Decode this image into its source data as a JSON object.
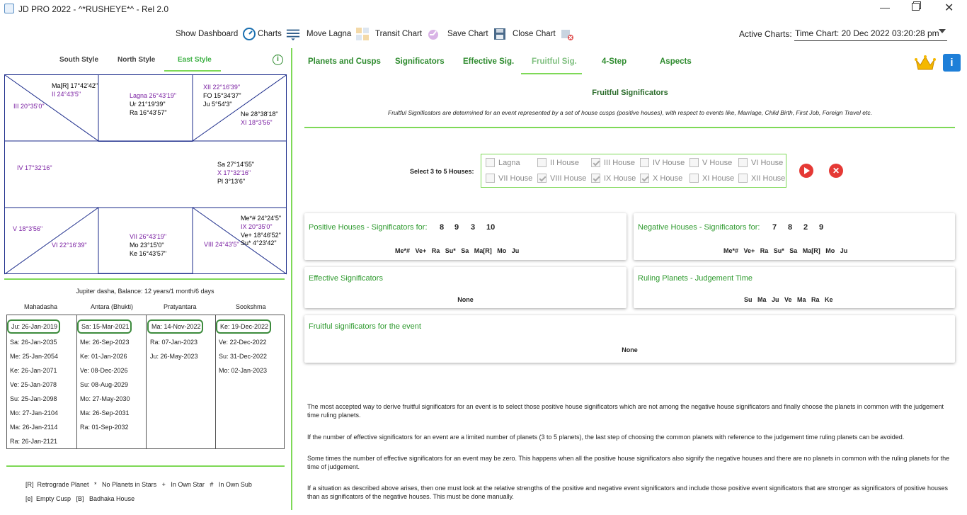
{
  "window": {
    "title": "JD PRO 2022 - ^*RUSHEYE*^  - Rel 2.0",
    "controls": [
      "minimize",
      "maximize",
      "close"
    ]
  },
  "toolbar": {
    "show_dashboard": "Show Dashboard",
    "charts": "Charts",
    "move_lagna": "Move Lagna",
    "transit_chart": "Transit Chart",
    "save_chart": "Save Chart",
    "close_chart": "Close Chart",
    "active_charts_label": "Active Charts:",
    "active_chart_value": "Time Chart: 20 Dec 2022 03:20:28 pm"
  },
  "left": {
    "style_tabs": [
      "South Style",
      "North Style",
      "East Style"
    ],
    "active_style": "East Style",
    "chart": {
      "tl_outer": [
        {
          "text": "Ma[R] 17°42'42\"",
          "color": "black"
        },
        {
          "text": "II 24°43'5\"",
          "color": "purple"
        },
        {
          "text": "III 20°35'0\"",
          "color": "purple"
        }
      ],
      "top_center": [
        {
          "text": "Lagna 26°43'19\"",
          "color": "purple"
        },
        {
          "text": "Ur 21°19'39\"",
          "color": "black"
        },
        {
          "text": "Ra 16°43'57\"",
          "color": "black"
        }
      ],
      "tr": [
        {
          "text": "XII 22°16'39\"",
          "color": "purple"
        },
        {
          "text": "FO  15°34'37\"",
          "color": "black"
        },
        {
          "text": "Ju 5°54'3\"",
          "color": "black"
        },
        {
          "text": "Ne 28°38'18\"",
          "color": "black"
        },
        {
          "text": "XI 18°3'56\"",
          "color": "purple"
        }
      ],
      "middle_left": [
        {
          "text": "IV 17°32'16\"",
          "color": "purple"
        }
      ],
      "middle_right": [
        {
          "text": "Sa 27°14'55\"",
          "color": "black"
        },
        {
          "text": "X 17°32'16\"",
          "color": "purple"
        },
        {
          "text": "Pl 3°13'6\"",
          "color": "black"
        }
      ],
      "bl": [
        {
          "text": "V 18°3'56\"",
          "color": "purple"
        },
        {
          "text": "VI 22°16'39\"",
          "color": "purple"
        }
      ],
      "bottom_center": [
        {
          "text": "VII 26°43'19\"",
          "color": "purple"
        },
        {
          "text": "Mo 23°15'0\"",
          "color": "black"
        },
        {
          "text": "Ke 16°43'57\"",
          "color": "black"
        }
      ],
      "br": [
        {
          "text": "Me*# 24°24'5\"",
          "color": "black"
        },
        {
          "text": "IX 20°35'0\"",
          "color": "purple"
        },
        {
          "text": "Ve+ 18°46'52\"",
          "color": "black"
        },
        {
          "text": "VIII 24°43'5\"",
          "color": "purple"
        },
        {
          "text": "Su* 4°23'42\"",
          "color": "black"
        }
      ]
    },
    "dasha_balance": "Jupiter dasha, Balance: 12 years/1 month/6 days",
    "dasha_headers": [
      "Mahadasha",
      "Antara (Bhukti)",
      "Pratyantara",
      "Sookshma"
    ],
    "mahadasha": [
      "Ju: 26-Jan-2019",
      "Sa: 26-Jan-2035",
      "Me: 25-Jan-2054",
      "Ke: 26-Jan-2071",
      "Ve: 25-Jan-2078",
      "Su: 25-Jan-2098",
      "Mo: 27-Jan-2104",
      "Ma: 26-Jan-2114",
      "Ra: 26-Jan-2121"
    ],
    "antara": [
      "Sa: 15-Mar-2021",
      "Me: 26-Sep-2023",
      "Ke: 01-Jan-2026",
      "Ve: 08-Dec-2026",
      "Su: 08-Aug-2029",
      "Mo: 27-May-2030",
      "Ma: 26-Sep-2031",
      "Ra: 01-Sep-2032"
    ],
    "pratyantara": [
      "Ma: 14-Nov-2022",
      "Ra: 07-Jan-2023",
      "Ju: 26-May-2023"
    ],
    "sookshma": [
      "Ke: 19-Dec-2022",
      "Ve: 22-Dec-2022",
      "Su: 31-Dec-2022",
      "Mo: 02-Jan-2023"
    ],
    "legend_line1": "[R]  Retrograde Planet   *   No Planets in Stars   +   In Own Star   #   In Own Sub",
    "legend_line2": "[e]  Empty Cusp   [B]   Badhaka House"
  },
  "right": {
    "tabs": [
      "Planets and Cusps",
      "Significators",
      "Effective Sig.",
      "Fruitful Sig.",
      "4-Step",
      "Aspects"
    ],
    "active_tab": "Fruitful Sig.",
    "heading": "Fruitful Significators",
    "description": "Fruitful Significators are determined for an event represented by a set of house cusps (positive houses), with respect to events like, Marriage, Child Birth, First Job, Foreign Travel etc.",
    "select_label": "Select 3 to 5 Houses:",
    "houses": [
      {
        "label": "Lagna",
        "checked": false
      },
      {
        "label": "II House",
        "checked": false
      },
      {
        "label": "III House",
        "checked": true
      },
      {
        "label": "IV House",
        "checked": false
      },
      {
        "label": "V House",
        "checked": false
      },
      {
        "label": "VI House",
        "checked": false
      },
      {
        "label": "VII House",
        "checked": false
      },
      {
        "label": "VIII House",
        "checked": true
      },
      {
        "label": "IX House",
        "checked": true
      },
      {
        "label": "X House",
        "checked": true
      },
      {
        "label": "XI House",
        "checked": false
      },
      {
        "label": "XII House",
        "checked": false
      }
    ],
    "positive": {
      "title": "Positive Houses - Significators for:",
      "houses": [
        "8",
        "9",
        "3",
        "10"
      ],
      "planets": "Me*#   Ve+   Ra   Su*   Sa   Ma[R]   Mo   Ju"
    },
    "negative": {
      "title": "Negative Houses - Significators for:",
      "houses": [
        "7",
        "8",
        "2",
        "9"
      ],
      "planets": "Me*#   Ve+   Ra   Su*   Sa   Ma[R]   Mo   Ju"
    },
    "effective": {
      "title": "Effective Significators",
      "value": "None"
    },
    "ruling": {
      "title": "Ruling Planets - Judgement Time",
      "value": "Su   Ma   Ju   Ve   Ma   Ra   Ke"
    },
    "fruitful": {
      "title": "Fruitful significators for the event",
      "value": "None"
    },
    "notes": [
      "The most accepted way to derive fruitful significators for an event is to select those positive house significators which are not among the negative house significators and finally choose the planets in common with the judgement time ruling planets.",
      "If the number of effective significators for an event are a limited number of planets (3 to 5 planets), the last step of choosing the common planets with reference to the judgement time ruling planets can be avoided.",
      "Some times the number of effective significators for an event may be zero. This happens when all the positive house significators also signify the negative houses and there are no planets in common with the ruling planets for the time of judgement.",
      "If a situation as described above arises, then one must look at the relative strengths of the positive and negative event significators and include those positive event significators that are stronger as significators of positive houses than as significators of the negative houses. This must be done manually."
    ]
  }
}
